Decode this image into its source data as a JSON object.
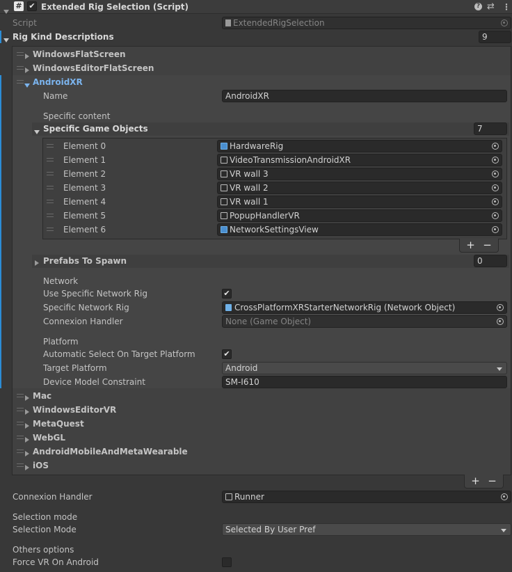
{
  "header": {
    "title": "Extended Rig Selection (Script)",
    "script_label": "Script",
    "script_value": "ExtendedRigSelection"
  },
  "rig_kinds": {
    "label": "Rig Kind Descriptions",
    "count": "9",
    "collapsed_before": [
      "WindowsFlatScreen",
      "WindowsEditorFlatScreen"
    ],
    "expanded_name": "AndroidXR",
    "collapsed_after": [
      "Mac",
      "WindowsEditorVR",
      "MetaQuest",
      "WebGL",
      "AndroidMobileAndMetaWearable",
      "iOS"
    ]
  },
  "android": {
    "name_label": "Name",
    "name_value": "AndroidXR",
    "specific_content_label": "Specific content",
    "sgo_label": "Specific Game Objects",
    "sgo_count": "7",
    "elements": [
      {
        "label": "Element 0",
        "value": "HardwareRig",
        "icon": "prefab-icon-blue"
      },
      {
        "label": "Element 1",
        "value": "VideoTransmissionAndroidXR",
        "icon": "gameobject-icon"
      },
      {
        "label": "Element 2",
        "value": "VR wall 3",
        "icon": "gameobject-icon"
      },
      {
        "label": "Element 3",
        "value": "VR wall 2",
        "icon": "gameobject-icon"
      },
      {
        "label": "Element 4",
        "value": "VR wall 1",
        "icon": "gameobject-icon"
      },
      {
        "label": "Element 5",
        "value": "PopupHandlerVR",
        "icon": "gameobject-icon"
      },
      {
        "label": "Element 6",
        "value": "NetworkSettingsView",
        "icon": "prefab-icon-blue"
      }
    ],
    "prefabs_label": "Prefabs To Spawn",
    "prefabs_count": "0",
    "network_header": "Network",
    "use_specific_label": "Use Specific Network Rig",
    "use_specific_checked": "✔",
    "specific_rig_label": "Specific Network Rig",
    "specific_rig_value": "CrossPlatformXRStarterNetworkRig (Network Object)",
    "connexion_label": "Connexion Handler",
    "connexion_value": "None (Game Object)",
    "platform_header": "Platform",
    "auto_select_label": "Automatic Select On Target Platform",
    "auto_select_checked": "✔",
    "target_platform_label": "Target Platform",
    "target_platform_value": "Android",
    "device_model_label": "Device Model Constraint",
    "device_model_value": "SM-I610"
  },
  "bottom": {
    "connexion_label": "Connexion Handler",
    "connexion_value": "Runner",
    "selection_mode_header": "Selection mode",
    "selection_mode_label": "Selection Mode",
    "selection_mode_value": "Selected By User Pref",
    "others_header": "Others options",
    "force_vr_label": "Force VR On Android"
  },
  "buttons": {
    "plus": "+",
    "minus": "−"
  },
  "colors": {
    "accent_blue": "#2c8dd6",
    "link_blue": "#7bb4ee",
    "bg": "#383838"
  }
}
